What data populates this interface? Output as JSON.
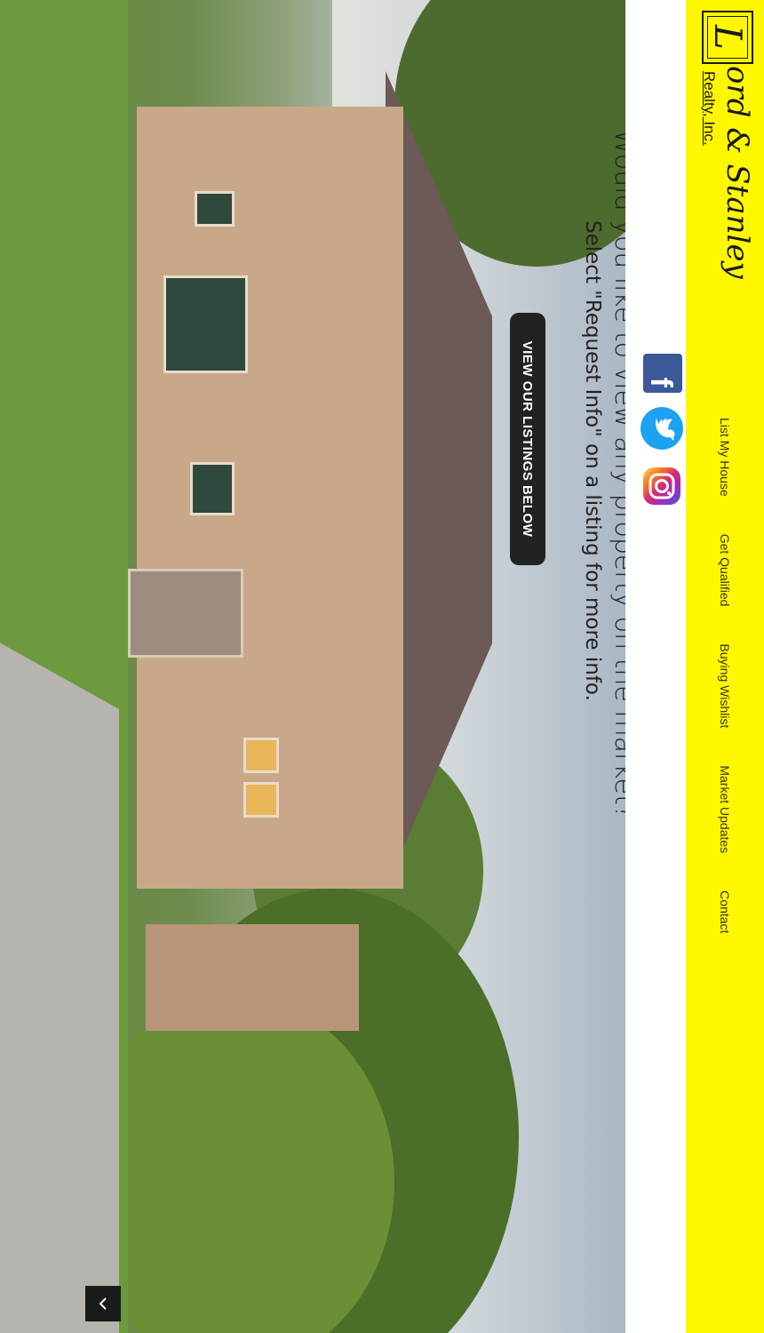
{
  "logo": {
    "initial": "L",
    "name": "ord & Stanley",
    "sub": "Realty, Inc."
  },
  "nav": {
    "items": [
      {
        "label": "List My House"
      },
      {
        "label": "Get Qualified"
      },
      {
        "label": "Buying Wishlist"
      },
      {
        "label": "Market Updates"
      },
      {
        "label": "Contact"
      }
    ]
  },
  "social": {
    "facebook_glyph": "f",
    "icons": [
      "facebook-icon",
      "twitter-icon",
      "instagram-icon"
    ]
  },
  "hero": {
    "headline": "Would you like to view any property on the market?",
    "subline": "Select \"Request Info\" on a listing for more info.",
    "cta_label": "VIEW OUR LISTINGS BELOW",
    "scroll_icon": "chevron-down-icon"
  },
  "colors": {
    "header_bg": "#fff700",
    "cta_bg": "#222222",
    "accent_dark": "#1a1a1a"
  }
}
